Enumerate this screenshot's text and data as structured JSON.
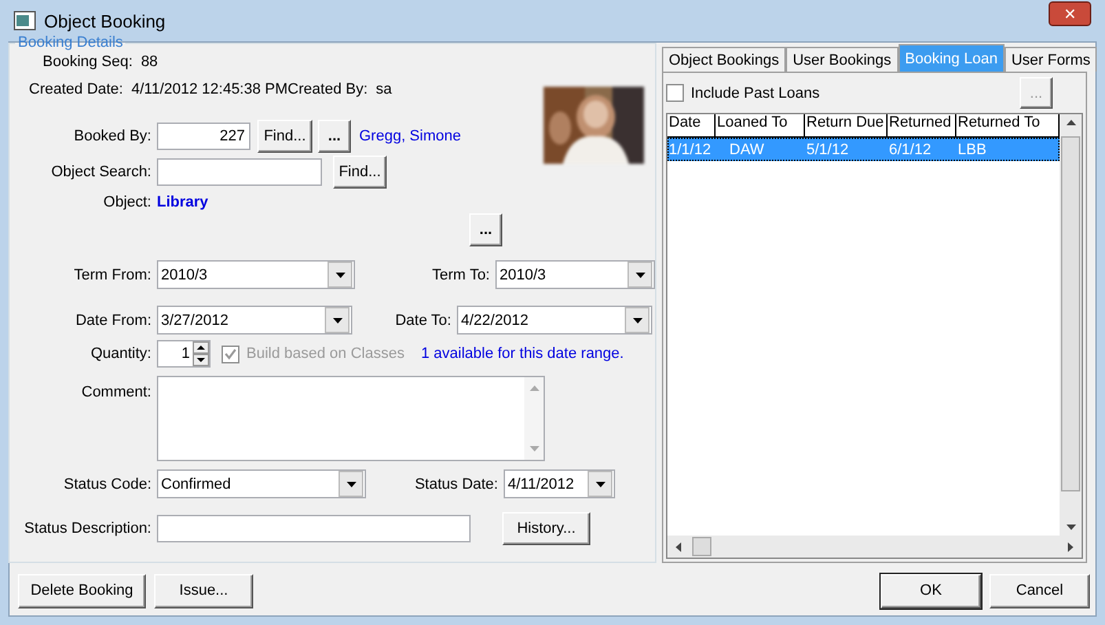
{
  "window": {
    "title": "Object Booking",
    "close": "✕"
  },
  "details": {
    "legend": "Booking Details",
    "booking_seq": {
      "label": "Booking Seq:",
      "value": "88"
    },
    "created_date": {
      "label": "Created Date:",
      "value": "4/11/2012 12:45:38 PM"
    },
    "created_by": {
      "label": "Created By:",
      "value": "sa"
    },
    "booked_by": {
      "label": "Booked By:",
      "value": "227",
      "find_button": "Find...",
      "more_button": "...",
      "name": "Gregg, Simone"
    },
    "object_search": {
      "label": "Object Search:",
      "find_button": "Find..."
    },
    "object": {
      "label": "Object:",
      "value": "Library",
      "more_button": "..."
    },
    "term_from": {
      "label": "Term From:",
      "value": "2010/3"
    },
    "term_to": {
      "label": "Term To:",
      "value": "2010/3"
    },
    "date_from": {
      "label": "Date From:",
      "value": "3/27/2012"
    },
    "date_to": {
      "label": "Date To:",
      "value": "4/22/2012"
    },
    "quantity": {
      "label": "Quantity:",
      "value": "1"
    },
    "build_classes": {
      "label": "Build based on Classes",
      "checked": true,
      "disabled": true
    },
    "availability": "1 available for this date range.",
    "comment": {
      "label": "Comment:"
    },
    "status_code": {
      "label": "Status Code:",
      "value": "Confirmed"
    },
    "status_date": {
      "label": "Status Date:",
      "value": "4/11/2012"
    },
    "status_description": {
      "label": "Status Description:"
    },
    "history_button": "History..."
  },
  "tabs": [
    {
      "label": "Object Bookings",
      "selected": false
    },
    {
      "label": "User Bookings",
      "selected": false
    },
    {
      "label": "Booking Loan",
      "selected": true
    },
    {
      "label": "User Forms",
      "selected": false
    }
  ],
  "loans": {
    "include_past": {
      "label": "Include Past Loans",
      "checked": false
    },
    "more_button": {
      "label": "...",
      "disabled": true
    },
    "table": {
      "columns": [
        "Date",
        "Loaned To",
        "Return Due",
        "Returned",
        "Returned To"
      ],
      "rows": [
        {
          "cells": [
            "1/1/12",
            "DAW",
            "5/1/12",
            "6/1/12",
            "LBB"
          ],
          "selected": true
        }
      ]
    }
  },
  "buttons_left": [
    "Delete Booking",
    "Issue..."
  ],
  "buttons_right": [
    {
      "label": "OK",
      "default": true
    },
    {
      "label": "Cancel",
      "default": false
    }
  ]
}
